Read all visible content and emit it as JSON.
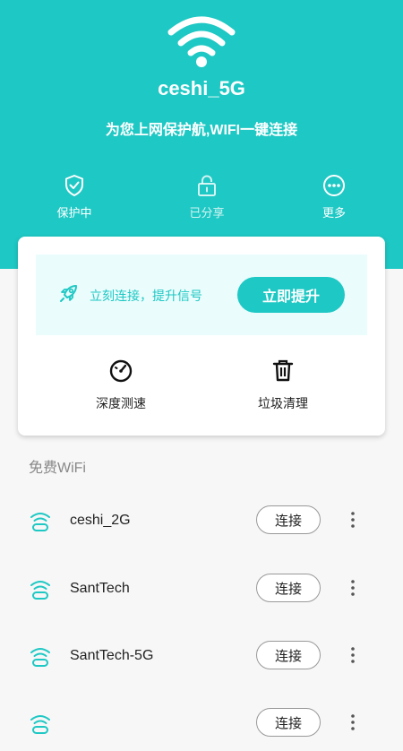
{
  "header": {
    "ssid": "ceshi_5G",
    "slogan": "为您上网保护航,WIFI一键连接",
    "actions": [
      {
        "label": "保护中",
        "icon": "shield-check-icon"
      },
      {
        "label": "已分享",
        "icon": "lock-icon"
      },
      {
        "label": "更多",
        "icon": "more-icon"
      }
    ]
  },
  "boost": {
    "tip": "立刻连接，提升信号",
    "button": "立即提升",
    "icon": "rocket-icon"
  },
  "tools": [
    {
      "label": "深度测速",
      "icon": "speedometer-icon"
    },
    {
      "label": "垃圾清理",
      "icon": "trash-icon"
    }
  ],
  "wifi_section": {
    "title": "免费WiFi",
    "connect_label": "连接",
    "networks": [
      {
        "name": "ceshi_2G"
      },
      {
        "name": "SantTech"
      },
      {
        "name": "SantTech-5G"
      },
      {
        "name": ""
      }
    ]
  },
  "colors": {
    "accent": "#1ec8c4",
    "boost_bg": "#eafcfc",
    "page_bg": "#f7f7f7"
  }
}
